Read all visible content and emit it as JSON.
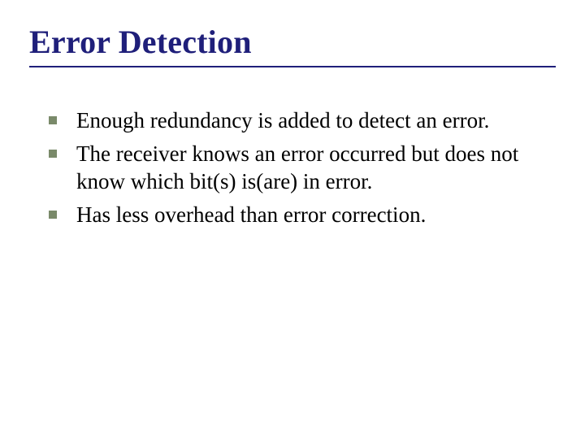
{
  "slide": {
    "title": "Error Detection",
    "bullets": [
      "Enough redundancy is added to detect an error.",
      "The receiver knows an error occurred but does not know which bit(s) is(are) in error.",
      "Has less overhead than error correction."
    ]
  }
}
